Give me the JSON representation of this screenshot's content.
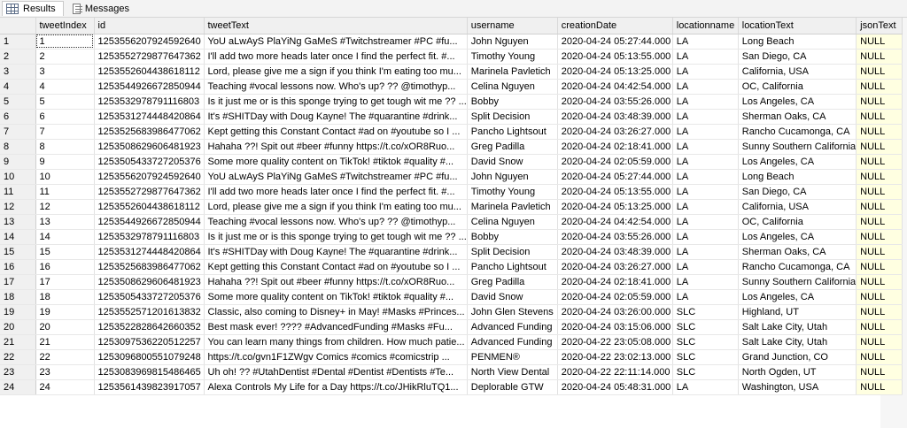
{
  "tabs": [
    {
      "label": "Results",
      "icon": "grid-icon"
    },
    {
      "label": "Messages",
      "icon": "message-icon"
    }
  ],
  "columns": [
    "tweetIndex",
    "id",
    "tweetText",
    "username",
    "creationDate",
    "locationname",
    "locationText",
    "jsonText"
  ],
  "rows": [
    [
      "1",
      "1",
      "1253556207924592640",
      "YoU aLwAyS PlaYiNg GaMeS #Twitchstreamer #PC #fu...",
      "John Nguyen",
      "2020-04-24 05:27:44.000",
      "LA",
      "Long Beach",
      "NULL"
    ],
    [
      "2",
      "2",
      "1253552729877647362",
      "I'll add two more heads later once I find the perfect fit.   #...",
      "Timothy Young",
      "2020-04-24 05:13:55.000",
      "LA",
      "San Diego, CA",
      "NULL"
    ],
    [
      "3",
      "3",
      "1253552604438618112",
      "Lord, please give me a sign if you think I'm eating too mu...",
      "Marinela Pavletich",
      "2020-04-24 05:13:25.000",
      "LA",
      "California, USA",
      "NULL"
    ],
    [
      "4",
      "4",
      "1253544926672850944",
      "Teaching #vocal lessons now. Who's up? ?? @timothyp...",
      "Celina Nguyen",
      "2020-04-24 04:42:54.000",
      "LA",
      "OC, California",
      "NULL"
    ],
    [
      "5",
      "5",
      "1253532978791116803",
      "Is it just me or is this sponge trying to get tough wit me ?? ...",
      "Bobby",
      "2020-04-24 03:55:26.000",
      "LA",
      "Los Angeles, CA",
      "NULL"
    ],
    [
      "6",
      "6",
      "1253531274448420864",
      "It's #SHITDay with Doug Kayne! The #quarantine #drink...",
      "Split Decision",
      "2020-04-24 03:48:39.000",
      "LA",
      "Sherman Oaks, CA",
      "NULL"
    ],
    [
      "7",
      "7",
      "1253525683986477062",
      "Kept getting this Constant Contact #ad on #youtube so I ...",
      "Pancho Lightsout",
      "2020-04-24 03:26:27.000",
      "LA",
      "Rancho Cucamonga, CA",
      "NULL"
    ],
    [
      "8",
      "8",
      "1253508629606481923",
      "Hahaha ??! Spit out #beer #funny https://t.co/xOR8Ruo...",
      "Greg Padilla",
      "2020-04-24 02:18:41.000",
      "LA",
      "Sunny Southern California",
      "NULL"
    ],
    [
      "9",
      "9",
      "1253505433727205376",
      "Some more quality content on TikTok! #tiktok #quality #...",
      "David Snow",
      "2020-04-24 02:05:59.000",
      "LA",
      "Los Angeles, CA",
      "NULL"
    ],
    [
      "10",
      "10",
      "1253556207924592640",
      "YoU aLwAyS PlaYiNg GaMeS #Twitchstreamer #PC #fu...",
      "John Nguyen",
      "2020-04-24 05:27:44.000",
      "LA",
      "Long Beach",
      "NULL"
    ],
    [
      "11",
      "11",
      "1253552729877647362",
      "I'll add two more heads later once I find the perfect fit.   #...",
      "Timothy Young",
      "2020-04-24 05:13:55.000",
      "LA",
      "San Diego, CA",
      "NULL"
    ],
    [
      "12",
      "12",
      "1253552604438618112",
      "Lord, please give me a sign if you think I'm eating too mu...",
      "Marinela Pavletich",
      "2020-04-24 05:13:25.000",
      "LA",
      "California, USA",
      "NULL"
    ],
    [
      "13",
      "13",
      "1253544926672850944",
      "Teaching #vocal lessons now. Who's up? ?? @timothyp...",
      "Celina Nguyen",
      "2020-04-24 04:42:54.000",
      "LA",
      "OC, California",
      "NULL"
    ],
    [
      "14",
      "14",
      "1253532978791116803",
      "Is it just me or is this sponge trying to get tough wit me ?? ...",
      "Bobby",
      "2020-04-24 03:55:26.000",
      "LA",
      "Los Angeles, CA",
      "NULL"
    ],
    [
      "15",
      "15",
      "1253531274448420864",
      "It's #SHITDay with Doug Kayne! The #quarantine #drink...",
      "Split Decision",
      "2020-04-24 03:48:39.000",
      "LA",
      "Sherman Oaks, CA",
      "NULL"
    ],
    [
      "16",
      "16",
      "1253525683986477062",
      "Kept getting this Constant Contact #ad on #youtube so I ...",
      "Pancho Lightsout",
      "2020-04-24 03:26:27.000",
      "LA",
      "Rancho Cucamonga, CA",
      "NULL"
    ],
    [
      "17",
      "17",
      "1253508629606481923",
      "Hahaha ??! Spit out #beer #funny https://t.co/xOR8Ruo...",
      "Greg Padilla",
      "2020-04-24 02:18:41.000",
      "LA",
      "Sunny Southern California",
      "NULL"
    ],
    [
      "18",
      "18",
      "1253505433727205376",
      "Some more quality content on TikTok! #tiktok #quality #...",
      "David Snow",
      "2020-04-24 02:05:59.000",
      "LA",
      "Los Angeles, CA",
      "NULL"
    ],
    [
      "19",
      "19",
      "1253552571201613832",
      "Classic, also coming to Disney+ in May! #Masks #Princes...",
      "John Glen Stevens",
      "2020-04-24 03:26:00.000",
      "SLC",
      "Highland, UT",
      "NULL"
    ],
    [
      "20",
      "20",
      "1253522828642660352",
      "Best mask ever!  ????  #AdvancedFunding #Masks #Fu...",
      "Advanced Funding",
      "2020-04-24 03:15:06.000",
      "SLC",
      "Salt Lake City, Utah",
      "NULL"
    ],
    [
      "21",
      "21",
      "1253097536220512257",
      "You can learn many things from children. How much patie...",
      "Advanced Funding",
      "2020-04-22 23:05:08.000",
      "SLC",
      "Salt Lake City, Utah",
      "NULL"
    ],
    [
      "22",
      "22",
      "1253096800551079248",
      "https://t.co/gvn1F1ZWgv Comics #comics #comicstrip ...",
      "PENMEN®",
      "2020-04-22 23:02:13.000",
      "SLC",
      "Grand Junction, CO",
      "NULL"
    ],
    [
      "23",
      "23",
      "1253083969815486465",
      "Uh oh! ?? #UtahDentist #Dental #Dentist #Dentists #Te...",
      "North View Dental",
      "2020-04-22 22:11:14.000",
      "SLC",
      "North Ogden, UT",
      "NULL"
    ],
    [
      "24",
      "24",
      "1253561439823917057",
      "Alexa Controls My Life for a Day https://t.co/JHikRluTQ1...",
      "Deplorable GTW",
      "2020-04-24 05:48:31.000",
      "LA",
      "Washington, USA",
      "NULL"
    ]
  ],
  "colors": {
    "null_cell": "#ffffe1",
    "header_bg": "#f0f0f0"
  }
}
